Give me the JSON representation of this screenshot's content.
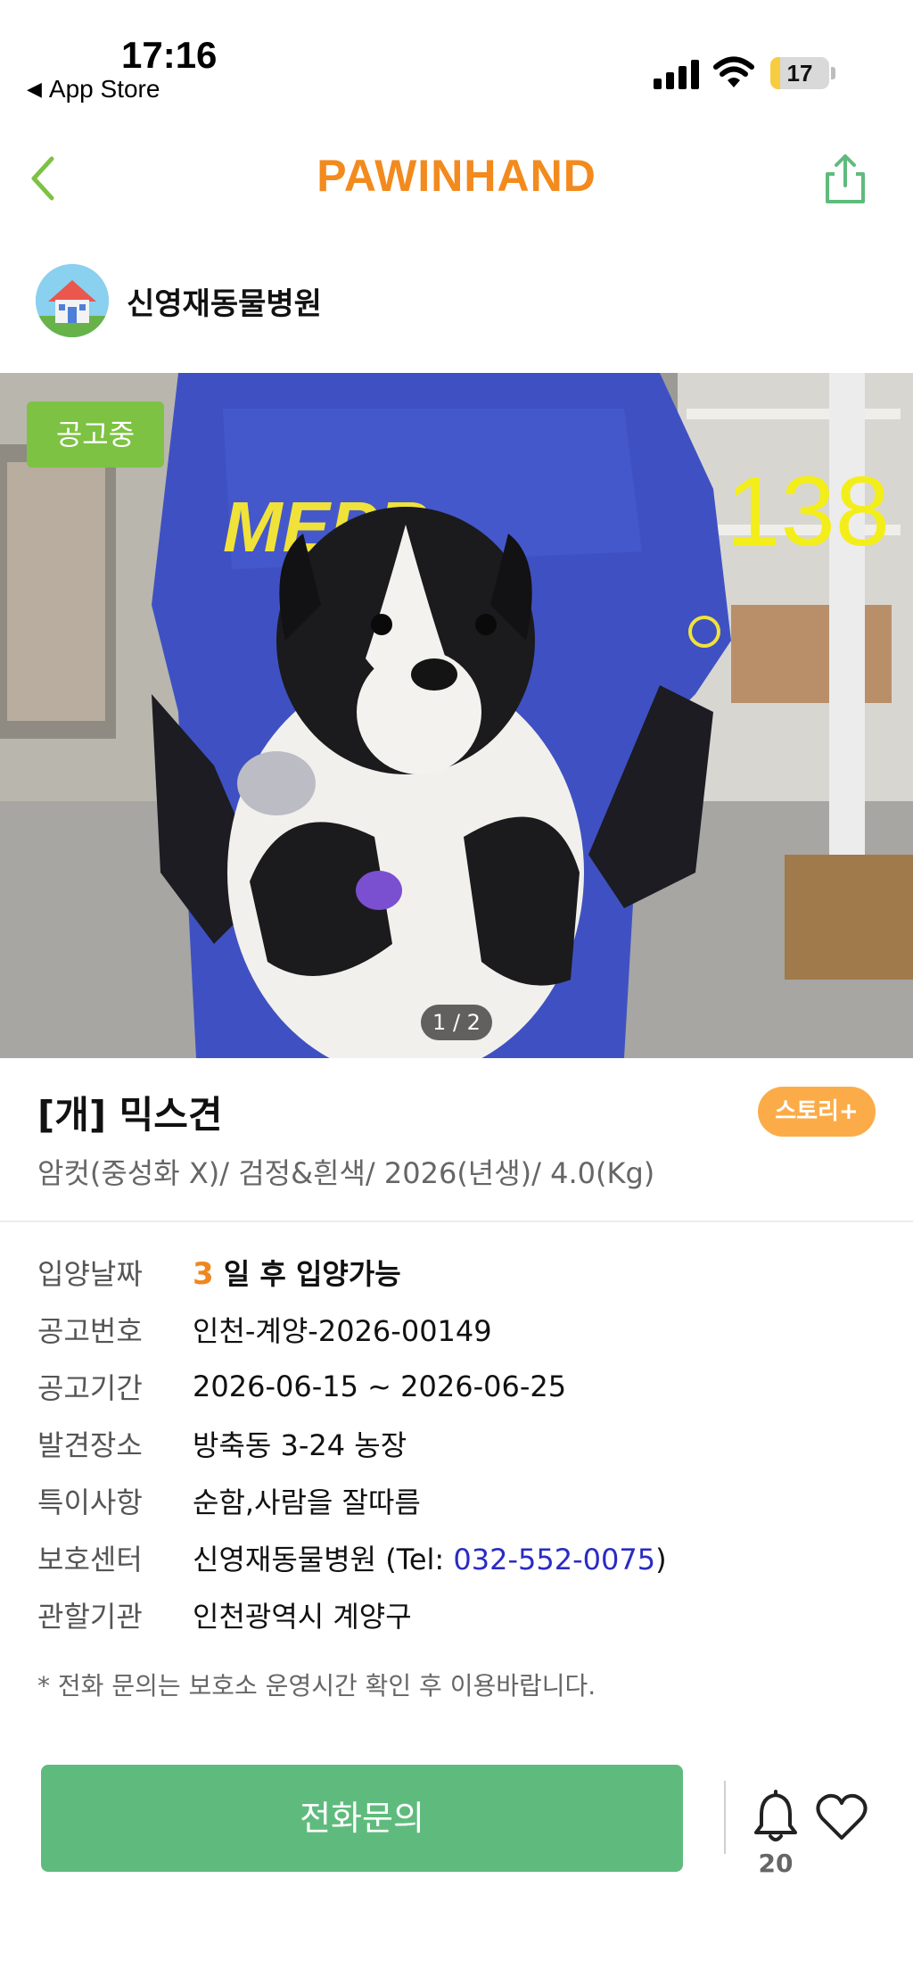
{
  "status_bar": {
    "time": "17:16",
    "back_app": "App Store",
    "battery": "17",
    "battery_level": 0.17
  },
  "header": {
    "logo": "PAWINHAND",
    "icons": [
      "chevron-left-icon",
      "share-icon"
    ]
  },
  "shelter": {
    "name": "신영재동물병원"
  },
  "photo": {
    "status_tag": "공고중",
    "number": "138",
    "pager": "1 / 2"
  },
  "animal": {
    "title": "[개] 믹스견",
    "story_button": "스토리+",
    "summary": "암컷(중성화 X)/ 검정&흰색/ 2026(년생)/ 4.0(Kg)"
  },
  "details": {
    "adoption_date": {
      "label": "입양날짜",
      "number": "3",
      "text": "일 후 입양가능"
    },
    "notice_no": {
      "label": "공고번호",
      "value": "인천-계양-2026-00149"
    },
    "notice_period": {
      "label": "공고기간",
      "value": "2026-06-15 ~ 2026-06-25"
    },
    "found_place": {
      "label": "발견장소",
      "value": "방축동 3-24 농장"
    },
    "special_notes": {
      "label": "특이사항",
      "value": "순함,사람을 잘따름"
    },
    "shelter": {
      "label": "보호센터",
      "name": "신영재동물병원 (Tel: ",
      "phone": "032-552-0075",
      "suffix": ")"
    },
    "agency": {
      "label": "관할기관",
      "value": "인천광역시 계양구"
    }
  },
  "notice": "* 전화 문의는 보호소 운영시간 확인 후 이용바랍니다.",
  "bottom": {
    "call_button": "전화문의",
    "bell_count": "20",
    "accent": "#5fbb7d"
  }
}
